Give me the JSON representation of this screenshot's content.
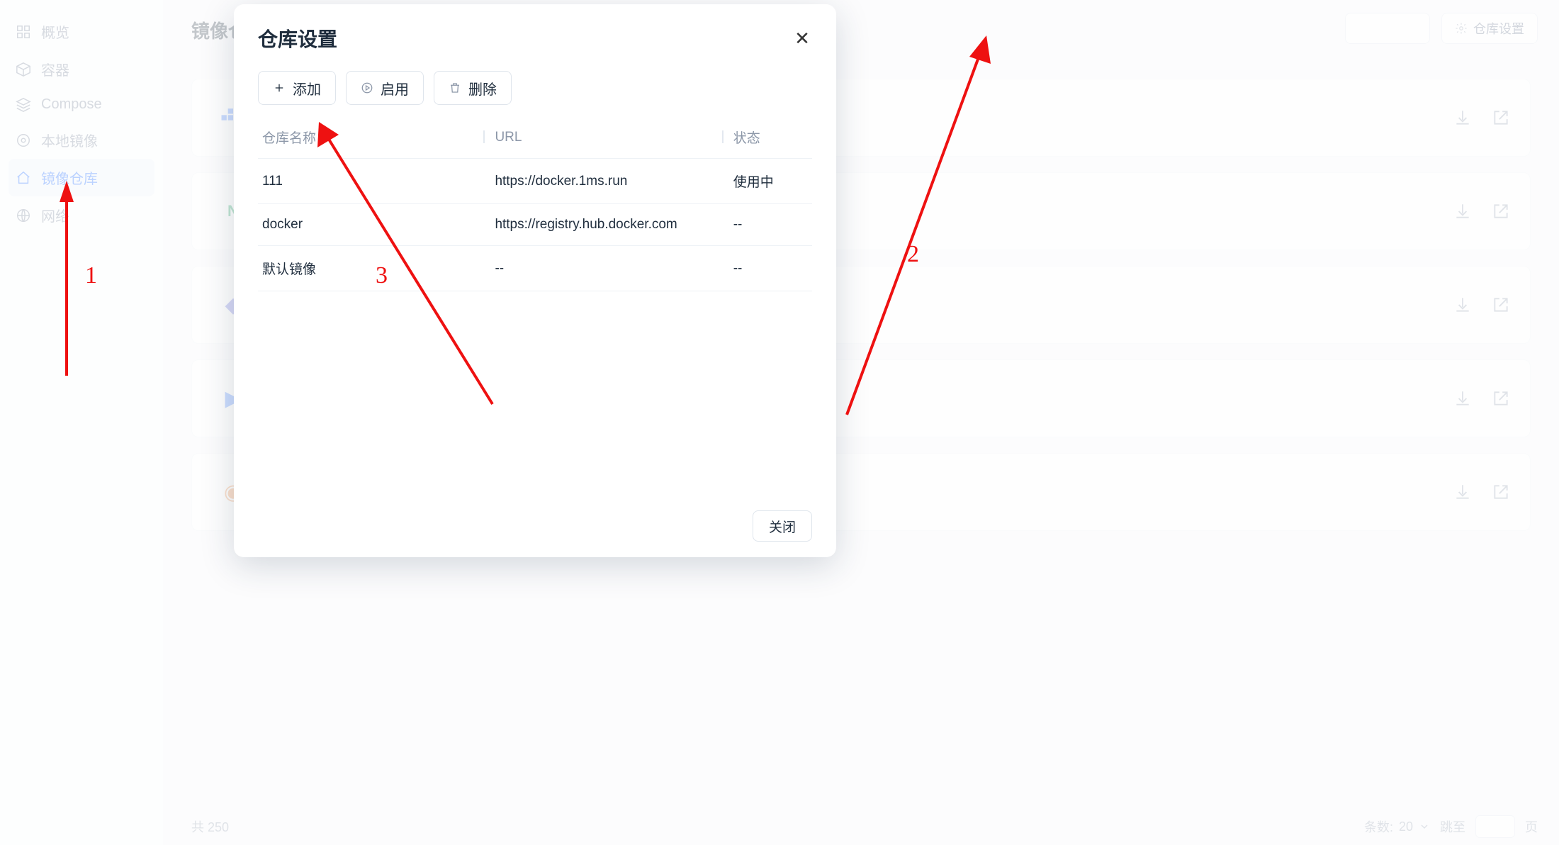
{
  "sidebar": {
    "items": [
      {
        "label": "概览",
        "icon": "grid-icon",
        "active": false
      },
      {
        "label": "容器",
        "icon": "cube-icon",
        "active": false
      },
      {
        "label": "Compose",
        "icon": "layers-icon",
        "active": false
      },
      {
        "label": "本地镜像",
        "icon": "disc-icon",
        "active": false
      },
      {
        "label": "镜像仓库",
        "icon": "home-icon",
        "active": true
      },
      {
        "label": "网络",
        "icon": "globe-icon",
        "active": false
      }
    ]
  },
  "page": {
    "title_partial": "镜像仓",
    "settings_button": "仓库设置"
  },
  "pager": {
    "total_prefix": "共 250",
    "page_size_label": "条数:",
    "page_size_value": "20",
    "jump_label": "跳至",
    "jump_suffix": "页"
  },
  "modal": {
    "title": "仓库设置",
    "buttons": {
      "add": "添加",
      "enable": "启用",
      "delete": "删除",
      "close": "关闭"
    },
    "columns": {
      "name": "仓库名称",
      "url": "URL",
      "status": "状态"
    },
    "rows": [
      {
        "name": "111",
        "url": "https://docker.1ms.run",
        "status": "使用中",
        "status_kind": "active"
      },
      {
        "name": "docker",
        "url": "https://registry.hub.docker.com",
        "status": "--",
        "status_kind": "none"
      },
      {
        "name": "默认镜像",
        "url": "--",
        "status": "--",
        "status_kind": "none"
      }
    ]
  },
  "annotations": {
    "n1": "1",
    "n2": "2",
    "n3": "3"
  }
}
